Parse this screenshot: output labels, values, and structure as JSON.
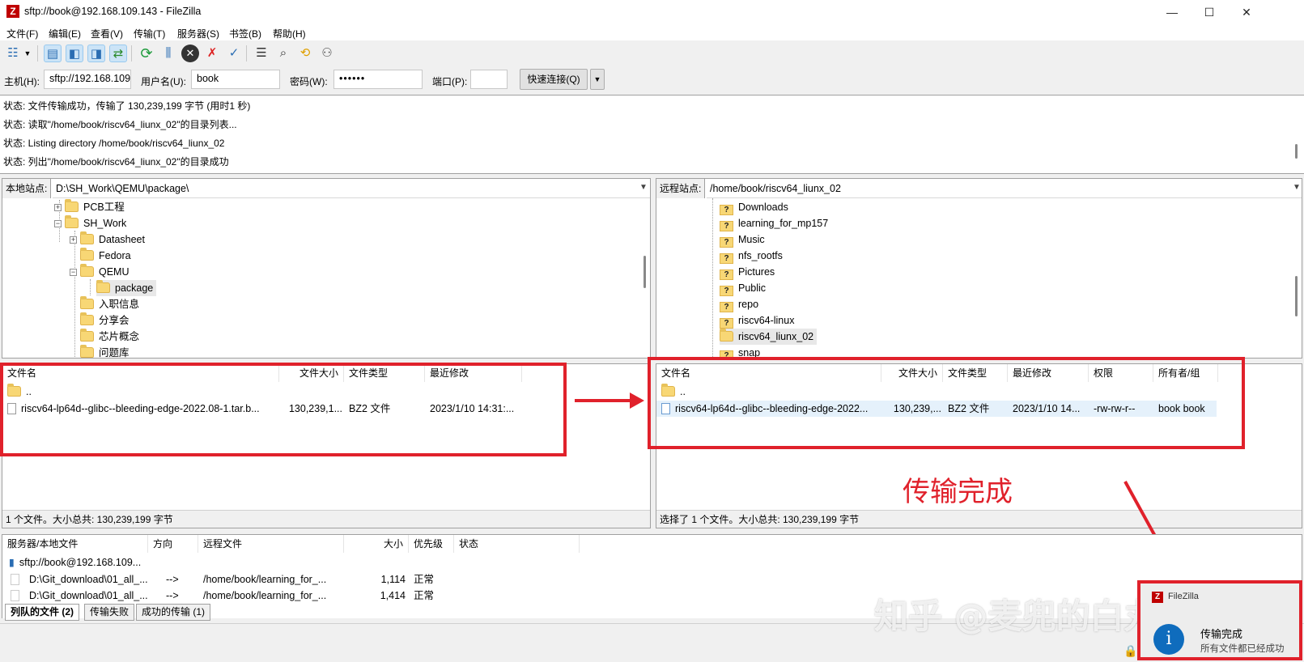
{
  "window": {
    "title": "sftp://book@192.168.109.143 - FileZilla",
    "app_icon": "Z",
    "controls": [
      "—",
      "☐",
      "✕"
    ]
  },
  "menu": [
    "文件(F)",
    "编辑(E)",
    "查看(V)",
    "传输(T)",
    "服务器(S)",
    "书签(B)",
    "帮助(H)"
  ],
  "toolbar": {
    "icons": [
      "site-manager-icon",
      "toggle-log-icon",
      "toggle-local-tree-icon",
      "toggle-remote-tree-icon",
      "toggle-queue-icon",
      "refresh-icon",
      "process-queue-icon",
      "cancel-icon",
      "disconnect-icon",
      "reconnect-icon",
      "filter-icon",
      "search-icon",
      "compare-icon",
      "binoculars-icon"
    ]
  },
  "quickconnect": {
    "host_label": "主机(H):",
    "host_value": "sftp://192.168.109",
    "user_label": "用户名(U):",
    "user_value": "book",
    "pass_label": "密码(W):",
    "pass_value": "••••••",
    "port_label": "端口(P):",
    "port_value": "",
    "connect_label": "快速连接(Q)"
  },
  "log": [
    "状态: 文件传输成功，传输了 130,239,199 字节 (用时1 秒)",
    "状态: 读取\"/home/book/riscv64_liunx_02\"的目录列表...",
    "状态: Listing directory /home/book/riscv64_liunx_02",
    "状态: 列出\"/home/book/riscv64_liunx_02\"的目录成功"
  ],
  "local": {
    "site_label": "本地站点:",
    "path": "D:\\SH_Work\\QEMU\\package\\",
    "tree": [
      "PCB工程",
      "SH_Work",
      "Datasheet",
      "Fedora",
      "QEMU",
      "package",
      "入职信息",
      "分享会",
      "芯片概念",
      "问题库"
    ],
    "columns": [
      "文件名",
      "文件大小",
      "文件类型",
      "最近修改"
    ],
    "parent": "..",
    "file": {
      "name": "riscv64-lp64d--glibc--bleeding-edge-2022.08-1.tar.b...",
      "size": "130,239,1...",
      "type": "BZ2 文件",
      "modified": "2023/1/10 14:31:..."
    },
    "status": "1 个文件。大小总共: 130,239,199 字节"
  },
  "remote": {
    "site_label": "远程站点:",
    "path": "/home/book/riscv64_liunx_02",
    "tree": [
      "Downloads",
      "learning_for_mp157",
      "Music",
      "nfs_rootfs",
      "Pictures",
      "Public",
      "repo",
      "riscv64-linux",
      "riscv64_liunx_02",
      "snap"
    ],
    "columns": [
      "文件名",
      "文件大小",
      "文件类型",
      "最近修改",
      "权限",
      "所有者/组"
    ],
    "parent": "..",
    "file": {
      "name": "riscv64-lp64d--glibc--bleeding-edge-2022...",
      "size": "130,239,...",
      "type": "BZ2 文件",
      "modified": "2023/1/10 14...",
      "perms": "-rw-rw-r--",
      "owner": "book book"
    },
    "status": "选择了 1 个文件。大小总共: 130,239,199 字节"
  },
  "queue": {
    "columns": [
      "服务器/本地文件",
      "方向",
      "远程文件",
      "大小",
      "优先级",
      "状态"
    ],
    "server": "sftp://book@192.168.109...",
    "rows": [
      {
        "local": "D:\\Git_download\\01_all_...",
        "dir": "-->",
        "remote": "/home/book/learning_for_...",
        "size": "1,114",
        "priority": "正常"
      },
      {
        "local": "D:\\Git_download\\01_all_...",
        "dir": "-->",
        "remote": "/home/book/learning_for_...",
        "size": "1,414",
        "priority": "正常"
      }
    ]
  },
  "tabs": [
    "列队的文件 (2)",
    "传输失败",
    "成功的传输 (1)"
  ],
  "annotation": {
    "text": "传输完成",
    "color": "#e0212b"
  },
  "watermark": "知乎 @麦兜的白丸相面",
  "notification": {
    "app": "FileZilla",
    "title": "传输完成",
    "body": "所有文件都已经成功"
  }
}
